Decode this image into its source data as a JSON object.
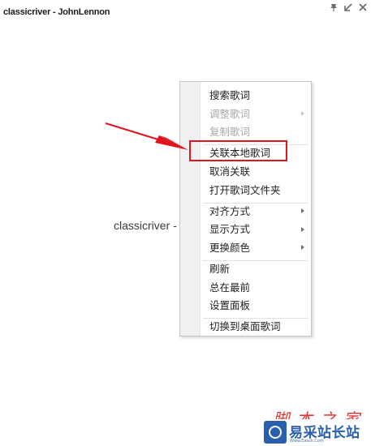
{
  "window": {
    "title": "classicriver - JohnLennon",
    "controls": [
      {
        "icon": "pin-icon",
        "label": "pin"
      },
      {
        "icon": "minimize-icon",
        "label": "minimize"
      },
      {
        "icon": "close-icon",
        "label": "close"
      }
    ]
  },
  "lyric": {
    "text": "classicriver -"
  },
  "context_menu": {
    "groups": [
      [
        {
          "label": "搜索歌词",
          "disabled": false,
          "submenu": false
        },
        {
          "label": "调整歌词",
          "disabled": true,
          "submenu": true
        },
        {
          "label": "复制歌词",
          "disabled": true,
          "submenu": false
        }
      ],
      [
        {
          "label": "关联本地歌词",
          "disabled": false,
          "submenu": false,
          "highlighted": true
        },
        {
          "label": "取消关联",
          "disabled": false,
          "submenu": false
        },
        {
          "label": "打开歌词文件夹",
          "disabled": false,
          "submenu": false
        }
      ],
      [
        {
          "label": "对齐方式",
          "disabled": false,
          "submenu": true
        },
        {
          "label": "显示方式",
          "disabled": false,
          "submenu": true
        },
        {
          "label": "更换颜色",
          "disabled": false,
          "submenu": true
        }
      ],
      [
        {
          "label": "刷新",
          "disabled": false,
          "submenu": false
        },
        {
          "label": "总在最前",
          "disabled": false,
          "submenu": false
        },
        {
          "label": "设置面板",
          "disabled": false,
          "submenu": false
        }
      ],
      [
        {
          "label": "切换到桌面歌词",
          "disabled": false,
          "submenu": false
        }
      ]
    ]
  },
  "annotation": {
    "color": "#e0141c"
  },
  "watermark": {
    "top_text": "脚本之家",
    "name": "易采站长站",
    "url": "Www.Easck.Com"
  }
}
